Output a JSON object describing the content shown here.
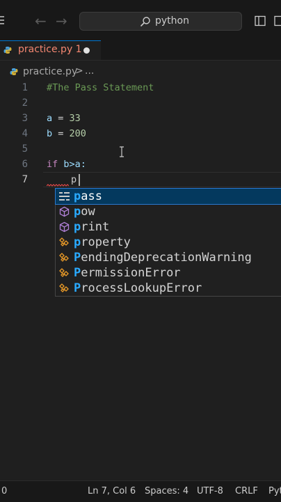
{
  "titlebar": {
    "search_text": "python",
    "back_arrow": "←",
    "forward_arrow": "→"
  },
  "tab": {
    "label": "practice.py 1"
  },
  "breadcrumb": {
    "file": "practice.py",
    "separator": ">",
    "more": "..."
  },
  "editor": {
    "line_numbers": [
      "1",
      "2",
      "3",
      "4",
      "5",
      "6",
      "7"
    ],
    "line1_comment": "#The Pass Statement",
    "line3_var": "a",
    "line3_op": " = ",
    "line3_num": "33",
    "line4_var": "b",
    "line4_op": " = ",
    "line4_num": "200",
    "line6_kw": "if",
    "line6_rest": " b>a:",
    "line7_text": "p"
  },
  "suggest": {
    "items": [
      {
        "match": "p",
        "rest": "ass",
        "kind": "keyword-icon"
      },
      {
        "match": "p",
        "rest": "ow",
        "kind": "method-icon"
      },
      {
        "match": "p",
        "rest": "rint",
        "kind": "method-icon"
      },
      {
        "match": "p",
        "rest": "roperty",
        "kind": "class-icon"
      },
      {
        "match": "P",
        "rest": "endingDeprecationWarning",
        "kind": "class-icon"
      },
      {
        "match": "P",
        "rest": "ermissionError",
        "kind": "class-icon"
      },
      {
        "match": "P",
        "rest": "rocessLookupError",
        "kind": "class-icon"
      }
    ]
  },
  "statusbar": {
    "left": "0",
    "position": "Ln 7, Col 6",
    "spaces": "Spaces: 4",
    "encoding": "UTF-8",
    "eol": "CRLF",
    "language": "Pyt"
  },
  "colors": {
    "accent": "#0078d4",
    "selection": "#04395e",
    "match_highlight": "#2aaaff",
    "error_tab": "#f48771"
  }
}
